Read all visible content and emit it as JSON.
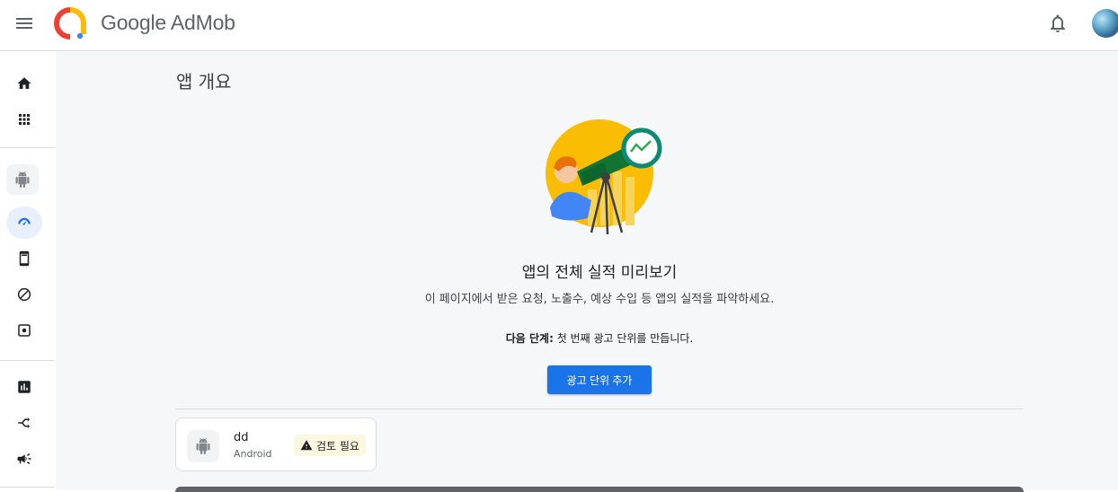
{
  "header": {
    "brand": "Google AdMob",
    "menu_icon": "hamburger-menu-icon",
    "notifications_icon": "bell-icon"
  },
  "sidebar": {
    "items": [
      {
        "icon": "home-icon"
      },
      {
        "icon": "apps-grid-icon"
      },
      {
        "icon": "android-app-icon"
      },
      {
        "icon": "dashboard-gauge-icon",
        "selected": true
      },
      {
        "icon": "ad-units-icon"
      },
      {
        "icon": "blocking-controls-icon"
      },
      {
        "icon": "app-settings-icon"
      },
      {
        "icon": "reports-icon"
      },
      {
        "icon": "mediation-icon"
      },
      {
        "icon": "campaigns-icon"
      }
    ]
  },
  "main": {
    "title": "앱 개요",
    "hero_title": "앱의 전체 실적 미리보기",
    "hero_subtitle": "이 페이지에서 받은 요청, 노출수, 예상 수입 등 앱의 실적을 파악하세요.",
    "next_step_label": "다음 단계:",
    "next_step_text": " 첫 번째 광고 단위를 만듭니다.",
    "cta_label": "광고 단위 추가"
  },
  "app_card": {
    "name": "dd",
    "platform": "Android",
    "status": "검토 필요"
  },
  "colors": {
    "accent": "#1a73e8",
    "selected_nav_bg": "#e8f0fe",
    "warning_bg": "#fef7e0"
  }
}
